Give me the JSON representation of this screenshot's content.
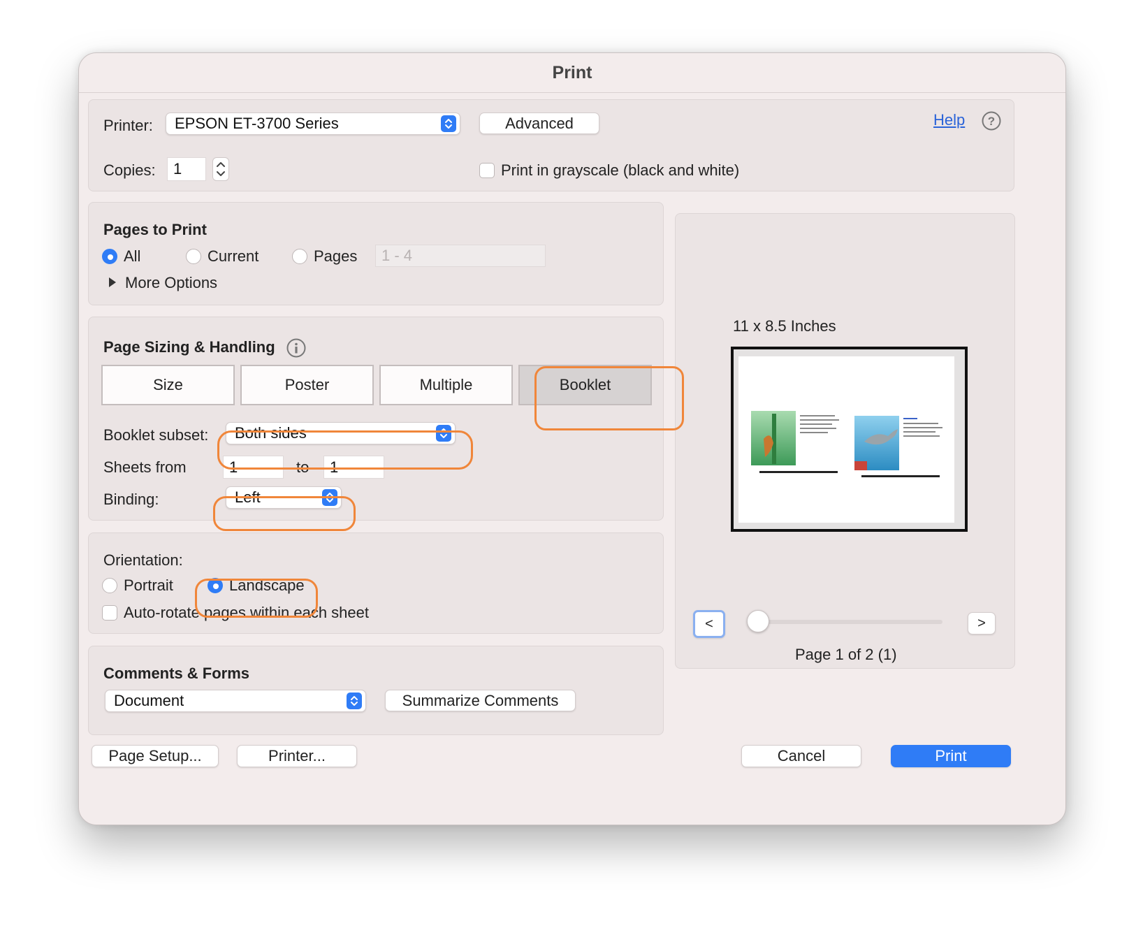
{
  "window": {
    "title": "Print"
  },
  "printer": {
    "label": "Printer:",
    "value": "EPSON ET-3700 Series",
    "advanced_label": "Advanced",
    "help_label": "Help",
    "copies_label": "Copies:",
    "copies_value": "1",
    "grayscale_label": "Print in grayscale (black and white)"
  },
  "pages_to_print": {
    "heading": "Pages to Print",
    "all_label": "All",
    "current_label": "Current",
    "pages_label": "Pages",
    "pages_placeholder": "1 - 4",
    "more_options_label": "More Options",
    "selected": "All"
  },
  "sizing": {
    "heading": "Page Sizing & Handling",
    "tabs": [
      "Size",
      "Poster",
      "Multiple",
      "Booklet"
    ],
    "selected_tab": "Booklet",
    "subset_label": "Booklet subset:",
    "subset_value": "Both sides",
    "sheets_from_label": "Sheets from",
    "sheets_from_value": "1",
    "to_label": "to",
    "sheets_to_value": "1",
    "binding_label": "Binding:",
    "binding_value": "Left"
  },
  "orientation": {
    "heading": "Orientation:",
    "portrait_label": "Portrait",
    "landscape_label": "Landscape",
    "selected": "Landscape",
    "autorotate_label": "Auto-rotate pages within each sheet"
  },
  "comments": {
    "heading": "Comments & Forms",
    "value": "Document",
    "summarize_label": "Summarize Comments"
  },
  "preview": {
    "size_label": "11 x 8.5 Inches",
    "prev_label": "<",
    "next_label": ">",
    "page_label": "Page 1 of 2 (1)",
    "slider_position": 0
  },
  "footer": {
    "page_setup_label": "Page Setup...",
    "printer_label": "Printer...",
    "cancel_label": "Cancel",
    "print_label": "Print"
  },
  "colors": {
    "accent": "#2f7cf6",
    "highlight": "#f0863a",
    "window_bg": "#f3ecec",
    "panel_bg": "#ebe4e4"
  }
}
